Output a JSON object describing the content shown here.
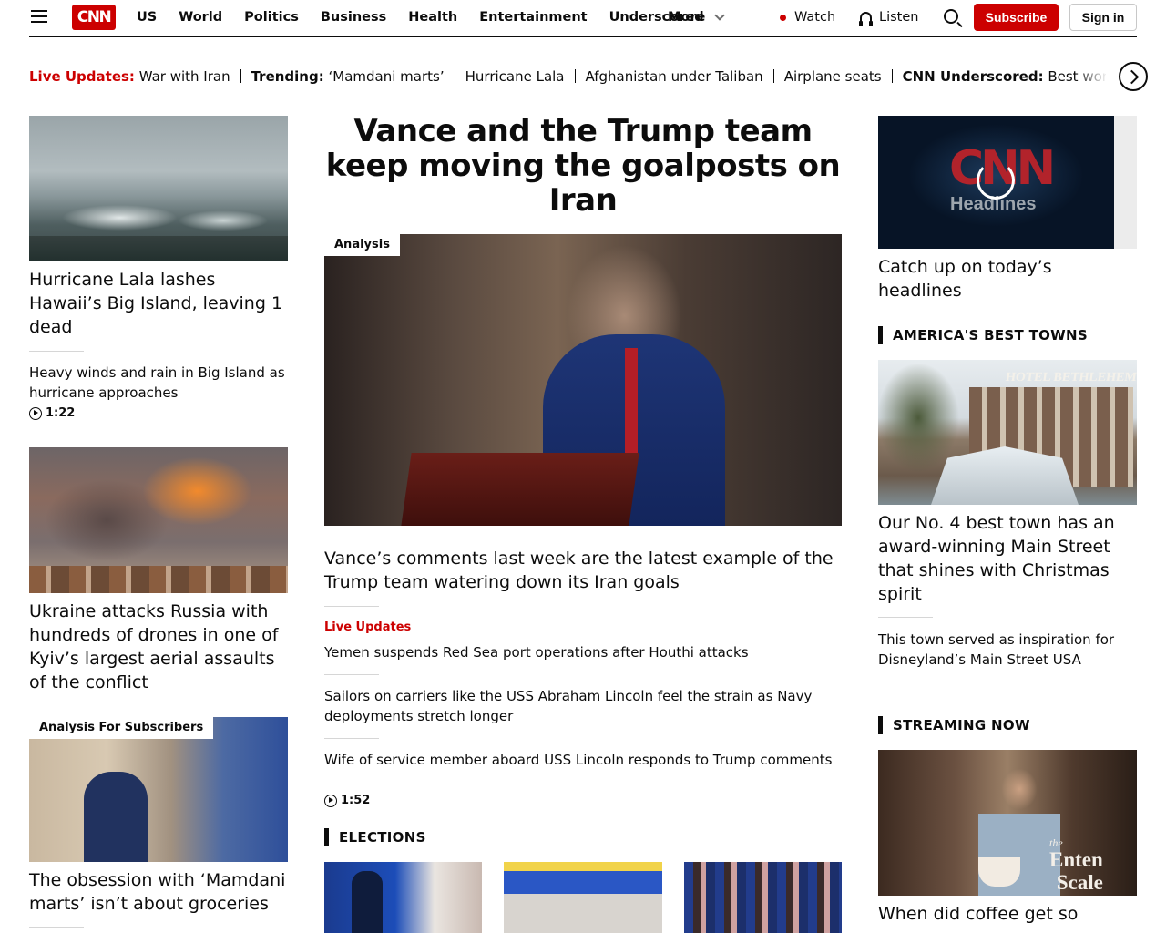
{
  "nav": {
    "logo": "CNN",
    "links": [
      "US",
      "World",
      "Politics",
      "Business",
      "Health",
      "Entertainment",
      "Underscored"
    ],
    "more_label": "More",
    "watch_label": "Watch",
    "listen_label": "Listen",
    "subscribe_label": "Subscribe",
    "signin_label": "Sign in",
    "accent_color": "#cc0000"
  },
  "trending": {
    "live_label": "Live Updates:",
    "live_text": "War with Iran",
    "trending_label": "Trending:",
    "trending_text": "‘Mamdani marts’",
    "items": [
      "Hurricane Lala",
      "Afghanistan under Taliban",
      "Airplane seats"
    ],
    "underscored_label": "CNN Underscored:",
    "underscored_text": "Best workou"
  },
  "left": {
    "story1": {
      "headline": "Hurricane Lala lashes Hawaii’s Big Island, leaving 1 dead",
      "related": "Heavy winds and rain in Big Island as hurricane approaches",
      "duration": "1:22"
    },
    "story2": {
      "headline": "Ukraine attacks Russia with hundreds of drones in one of Kyiv’s largest aerial assaults of the conflict"
    },
    "story3": {
      "tag": "Analysis For Subscribers",
      "headline": "The obsession with ‘Mamdani marts’ isn’t about groceries"
    }
  },
  "center": {
    "main_headline": "Vance and the Trump team keep moving the goalposts on Iran",
    "image_tag": "Analysis",
    "lead": "Vance’s comments last week are the latest example of the Trump team watering down its Iran goals",
    "live_label": "Live Updates",
    "items": [
      "Yemen suspends Red Sea port operations after Houthi attacks",
      "Sailors on carriers like the USS Abraham Lincoln feel the strain as Navy deployments stretch longer",
      "Wife of service member aboard USS Lincoln responds to Trump comments"
    ],
    "duration": "1:52",
    "section_elections": "ELECTIONS"
  },
  "right": {
    "video": {
      "logo": "CNN",
      "word": "Headlines",
      "headline": "Catch up on today’s headlines"
    },
    "section_towns": "AMERICA'S BEST TOWNS",
    "towns": {
      "sign": "HOTEL BETHLEHEM",
      "headline": "Our No. 4 best town has an award-winning Main Street that shines with Christmas spirit",
      "related": "This town served as inspiration for Disneyland’s Main Street USA"
    },
    "section_streaming": "STREAMING NOW",
    "streaming": {
      "overlay_small": "the",
      "overlay_line1": "Enten",
      "overlay_line2": "Scale",
      "headline": "When did coffee get so"
    }
  }
}
